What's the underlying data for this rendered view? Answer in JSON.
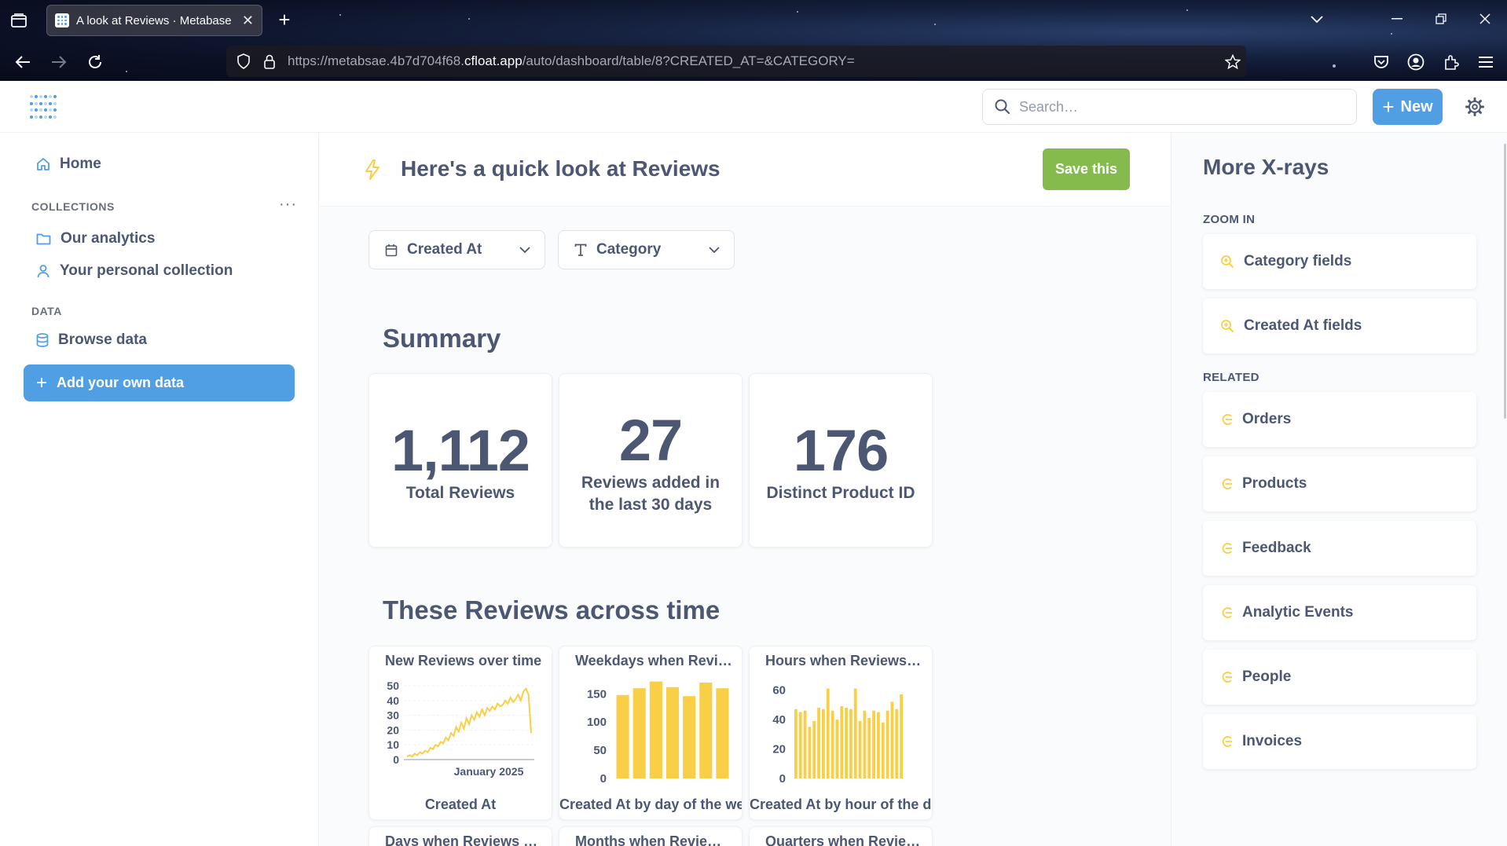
{
  "browser": {
    "tab_title": "A look at Reviews · Metabase",
    "url_prefix": "https://metabsae.4b7d704f68.",
    "url_domain": "cfloat.app",
    "url_path": "/auto/dashboard/table/8?CREATED_AT=&CATEGORY="
  },
  "navbar": {
    "search_placeholder": "Search…",
    "new_label": "New"
  },
  "sidebar": {
    "home_label": "Home",
    "collections_heading": "COLLECTIONS",
    "collections": [
      {
        "label": "Our analytics",
        "icon": "folder-icon"
      },
      {
        "label": "Your personal collection",
        "icon": "person-icon"
      }
    ],
    "data_heading": "DATA",
    "browse_data_label": "Browse data",
    "add_data_label": "Add your own data"
  },
  "main": {
    "title": "Here's a quick look at Reviews",
    "save_label": "Save this",
    "filters": [
      {
        "label": "Created At",
        "icon": "calendar-icon"
      },
      {
        "label": "Category",
        "icon": "text-icon"
      }
    ],
    "summary_title": "Summary",
    "scalars": [
      {
        "value": "1,112",
        "label": "Total Reviews"
      },
      {
        "value": "27",
        "label": "Reviews added in the last 30 days"
      },
      {
        "value": "176",
        "label": "Distinct Product ID"
      }
    ],
    "time_title": "These Reviews across time",
    "charts": [
      {
        "title": "New Reviews over time",
        "xlabel": "Created At",
        "x_tick": "January 2025"
      },
      {
        "title": "Weekdays when Revie...",
        "xlabel": "Created At by day of the week"
      },
      {
        "title": "Hours when Reviews w...",
        "xlabel": "Created At by hour of the day"
      }
    ],
    "more_chart_titles": [
      "Days when Reviews w...",
      "Months when Reviews ...",
      "Quarters when Review..."
    ]
  },
  "chart_data": [
    {
      "type": "line",
      "title": "New Reviews over time",
      "xlabel": "Created At",
      "ylim": [
        0,
        50
      ],
      "y_ticks": [
        0,
        10,
        20,
        30,
        40,
        50
      ],
      "x_tick_label": "January 2025",
      "values": [
        2,
        3,
        2,
        4,
        3,
        5,
        4,
        6,
        5,
        8,
        7,
        10,
        9,
        12,
        11,
        15,
        13,
        18,
        16,
        22,
        19,
        25,
        21,
        28,
        24,
        30,
        27,
        32,
        29,
        34,
        30,
        35,
        33,
        36,
        34,
        38,
        36,
        37,
        40,
        38,
        42,
        39,
        41,
        44,
        40,
        46,
        48,
        44,
        18
      ]
    },
    {
      "type": "bar",
      "title": "Weekdays when Revie...",
      "xlabel": "Created At by day of the week",
      "ylim": [
        0,
        170
      ],
      "y_ticks": [
        0,
        50,
        100,
        150
      ],
      "values": [
        148,
        160,
        172,
        162,
        146,
        170,
        160
      ]
    },
    {
      "type": "bar",
      "title": "Hours when Reviews w...",
      "xlabel": "Created At by hour of the day",
      "ylim": [
        0,
        65
      ],
      "y_ticks": [
        0,
        20,
        40,
        60
      ],
      "values": [
        47,
        45,
        46,
        35,
        39,
        48,
        47,
        61,
        46,
        40,
        49,
        48,
        47,
        61,
        39,
        46,
        41,
        46,
        45,
        38,
        46,
        52,
        47,
        57
      ]
    }
  ],
  "xray": {
    "title": "More X-rays",
    "zoom_heading": "ZOOM IN",
    "zoom_items": [
      "Category fields",
      "Created At fields"
    ],
    "related_heading": "RELATED",
    "related_items": [
      "Orders",
      "Products",
      "Feedback",
      "Analytic Events",
      "People",
      "Invoices"
    ]
  },
  "colors": {
    "brand": "#509ee3",
    "save": "#84bb4c",
    "chart": "#f9cf48",
    "text": "#4c5773"
  }
}
